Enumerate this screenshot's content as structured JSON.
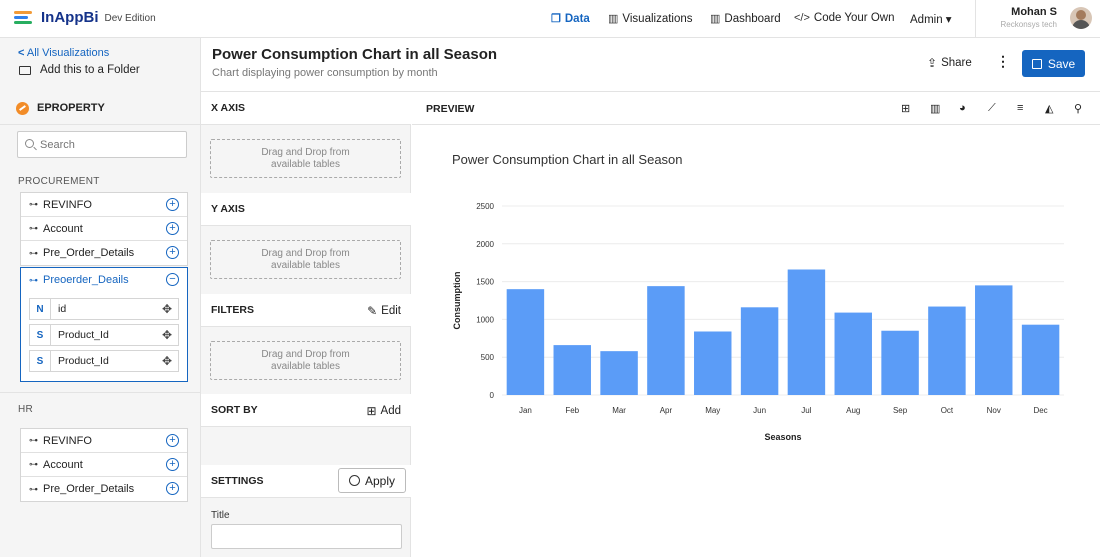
{
  "app": {
    "name": "InAppBi",
    "edition": "Dev Edition",
    "nav": [
      {
        "label": "Data",
        "icon": "copy-icon"
      },
      {
        "label": "Visualizations",
        "icon": "bar-chart-icon"
      },
      {
        "label": "Dashboard",
        "icon": "bar-chart-icon"
      },
      {
        "label": "Code Your Own",
        "icon": "code-icon"
      },
      {
        "label": "Admin ▾",
        "icon": ""
      }
    ],
    "user": {
      "name": "Mohan S",
      "org": "Reckonsys tech"
    }
  },
  "header": {
    "back_label": "All Visualizations",
    "folder_label": "Add this to a Folder",
    "title": "Power Consumption Chart in all Season",
    "subtitle": "Chart displaying power consumption by month",
    "share_label": "Share",
    "more_label": "⋮",
    "save_label": "Save"
  },
  "sidebar": {
    "datasource": "EPROPERTY",
    "search_placeholder": "Search",
    "groups": [
      {
        "name": "PROCUREMENT",
        "tables": [
          "REVINFO",
          "Account",
          "Pre_Order_Details"
        ],
        "expanded": {
          "name": "Preoerder_Deails",
          "fields": [
            {
              "type": "N",
              "name": "id"
            },
            {
              "type": "S",
              "name": "Product_Id"
            },
            {
              "type": "S",
              "name": "Product_Id"
            }
          ]
        }
      },
      {
        "name": "HR",
        "tables": [
          "REVINFO",
          "Account",
          "Pre_Order_Details"
        ]
      }
    ]
  },
  "config": {
    "x_axis": "X AXIS",
    "y_axis": "Y AXIS",
    "filters": "FILTERS",
    "filters_action": "Edit",
    "sort_by": "SORT BY",
    "sort_action": "Add",
    "settings": "SETTINGS",
    "apply_label": "Apply",
    "drop_hint": "Drag and Drop from available tables",
    "title_label": "Title",
    "title_value": ""
  },
  "preview": {
    "label": "PREVIEW",
    "chart_types": [
      "table-icon",
      "bar-chart-icon",
      "pie-chart-icon",
      "line-chart-icon",
      "list-icon",
      "area-chart-icon",
      "map-pin-icon"
    ]
  },
  "colors": {
    "accent": "#1565c0",
    "bar": "#5b9cf7"
  },
  "chart_data": {
    "type": "bar",
    "title": "Power Consumption Chart in all Season",
    "xlabel": "Seasons",
    "ylabel": "Consumption",
    "categories": [
      "Jan",
      "Feb",
      "Mar",
      "Apr",
      "May",
      "Jun",
      "Jul",
      "Aug",
      "Sep",
      "Oct",
      "Nov",
      "Dec"
    ],
    "values": [
      1400,
      660,
      580,
      1440,
      840,
      1160,
      1660,
      1090,
      850,
      1170,
      1450,
      930
    ],
    "ylim": [
      0,
      2500
    ],
    "yticks": [
      0,
      500,
      1000,
      1500,
      2000,
      2500
    ],
    "grid": true,
    "legend": "none"
  }
}
